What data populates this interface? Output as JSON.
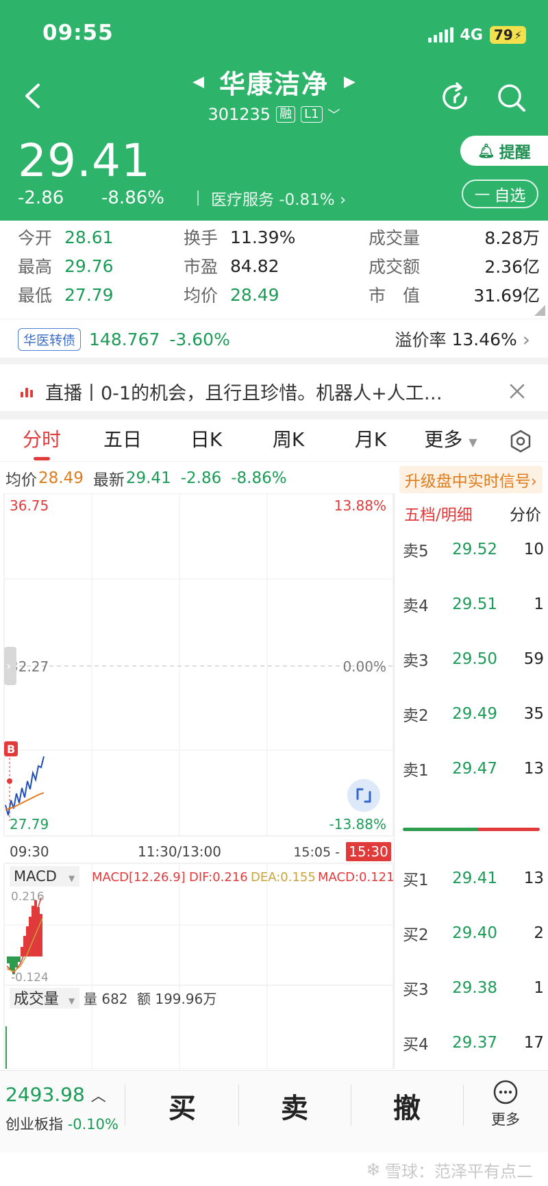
{
  "status": {
    "time": "09:55",
    "network": "4G",
    "battery": "79"
  },
  "header": {
    "stock_name": "华康洁净",
    "code": "301235",
    "tag_margin": "融",
    "tag_level": "L1",
    "price": "29.41",
    "change_abs": "-2.86",
    "change_pct": "-8.86%",
    "sector": "医疗服务",
    "sector_change": "-0.81%",
    "alert_label": "提醒",
    "watchlist_label": "自选"
  },
  "stats": {
    "open_label": "今开",
    "open": "28.61",
    "high_label": "最高",
    "high": "29.76",
    "low_label": "最低",
    "low": "27.79",
    "turnover_label": "换手",
    "turnover": "11.39%",
    "pe_label": "市盈",
    "pe": "84.82",
    "avg_label": "均价",
    "avg": "28.49",
    "volume_label": "成交量",
    "volume": "8.28万",
    "amount_label": "成交额",
    "amount": "2.36亿",
    "mcap_label": "市　值",
    "mcap": "31.69亿"
  },
  "bond": {
    "name": "华医转债",
    "price": "148.767",
    "change": "-3.60%",
    "premium_label": "溢价率",
    "premium": "13.46%"
  },
  "live": {
    "text": "直播丨0-1的机会，且行且珍惜。机器人+人工…"
  },
  "tabs": [
    {
      "label": "分时"
    },
    {
      "label": "五日"
    },
    {
      "label": "日K"
    },
    {
      "label": "周K"
    },
    {
      "label": "月K"
    },
    {
      "label": "更多"
    }
  ],
  "info_line": {
    "avg_label": "均价",
    "avg": "28.49",
    "latest_label": "最新",
    "latest": "29.41",
    "change_abs": "-2.86",
    "change_pct": "-8.86%",
    "upgrade_label": "升级盘中实时信号"
  },
  "chart": {
    "y_top": "36.75",
    "y_mid": "32.27",
    "y_bottom": "27.79",
    "pct_top": "13.88%",
    "pct_mid": "0.00%",
    "pct_bottom": "-13.88%",
    "buy_marker": "B",
    "x_start": "09:30",
    "x_mid": "11:30/13:00",
    "x_end": "15:05 -",
    "x_end_badge": "15:30",
    "macd_selector": "MACD",
    "macd_params": "MACD[12.26.9]",
    "dif": "DIF:0.216",
    "dea": "DEA:0.155",
    "macd_val": "MACD:0.121",
    "macd_top": "0.216",
    "macd_bottom": "-0.124",
    "volume_selector": "成交量",
    "vol_label": "量 682",
    "amt_label": "额 199.96万"
  },
  "orderbook": {
    "tab_active": "五档/明细",
    "tab_other": "分价",
    "asks": [
      {
        "side": "卖5",
        "price": "29.52",
        "qty": "10"
      },
      {
        "side": "卖4",
        "price": "29.51",
        "qty": "1"
      },
      {
        "side": "卖3",
        "price": "29.50",
        "qty": "59"
      },
      {
        "side": "卖2",
        "price": "29.49",
        "qty": "35"
      },
      {
        "side": "卖1",
        "price": "29.47",
        "qty": "13"
      }
    ],
    "bids": [
      {
        "side": "买1",
        "price": "29.41",
        "qty": "13"
      },
      {
        "side": "买2",
        "price": "29.40",
        "qty": "2"
      },
      {
        "side": "买3",
        "price": "29.38",
        "qty": "1"
      },
      {
        "side": "买4",
        "price": "29.37",
        "qty": "17"
      }
    ],
    "ratio_green": 0.55
  },
  "bottom": {
    "index_value": "2493.98",
    "index_name": "创业板指",
    "index_change": "-0.10%",
    "buy": "买",
    "sell": "卖",
    "cancel": "撤",
    "more": "更多"
  },
  "watermark": "雪球：范泽平有点二",
  "colors": {
    "brand_green": "#2db46a",
    "down": "#1a9b56",
    "up": "#e03a3a"
  }
}
